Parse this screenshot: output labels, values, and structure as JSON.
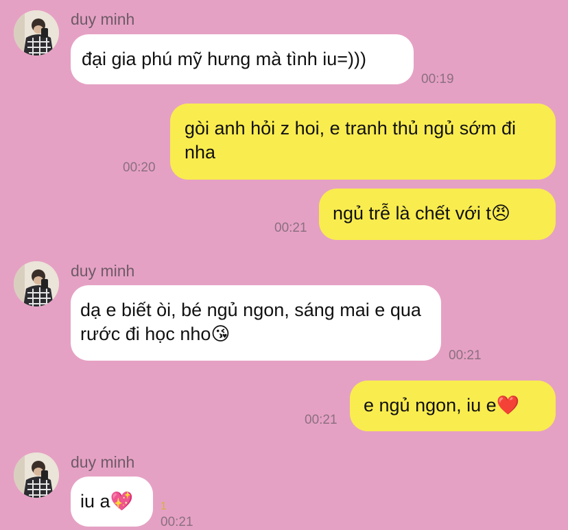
{
  "conversation": {
    "messages": [
      {
        "sender": "duy minh",
        "text": "đại gia phú mỹ hưng mà tình iu=)))",
        "time": "00:19",
        "direction": "in"
      },
      {
        "text": "gòi anh hỏi z hoi, e tranh thủ ngủ sớm đi nha",
        "time": "00:20",
        "direction": "out"
      },
      {
        "text": "ngủ trễ là chết với t",
        "emoji": "😠",
        "time": "00:21",
        "direction": "out"
      },
      {
        "sender": "duy minh",
        "text": "dạ e biết òi, bé ngủ ngon, sáng mai e qua rước đi học nho",
        "emoji": "😘",
        "time": "00:21",
        "direction": "in"
      },
      {
        "text": "e ngủ ngon, iu e",
        "emoji": "❤️",
        "time": "00:21",
        "direction": "out"
      },
      {
        "sender": "duy minh",
        "text": "iu a",
        "emoji": "💖",
        "time": "00:21",
        "read_count": "1",
        "direction": "in"
      }
    ]
  },
  "colors": {
    "background": "#E5A1C4",
    "outgoing_bubble": "#F9EC4F",
    "incoming_bubble": "#FFFFFF",
    "timestamp": "#8B6F80"
  },
  "icons": [
    "avatar-photo"
  ]
}
